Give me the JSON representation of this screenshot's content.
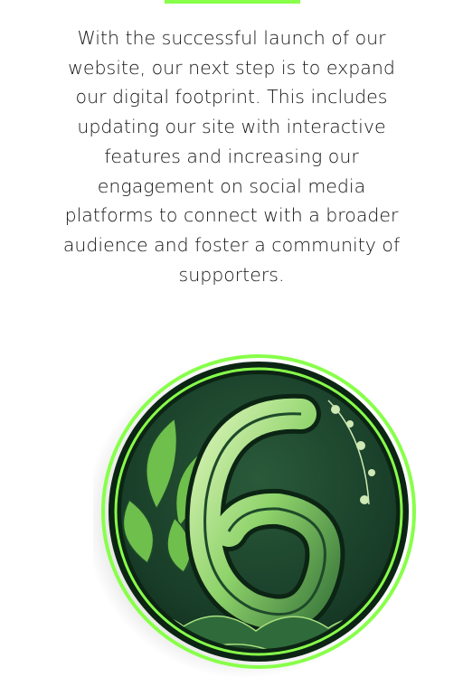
{
  "roadmap": {
    "description": "With the successful launch of our website, our next step is to expand our digital footprint. This includes updating our site with interactive features and increasing our engagement on social media platforms to connect with a broader audience and foster a community of supporters.",
    "step_numeral": "6"
  },
  "colors": {
    "accent": "#88ff4a",
    "ring_dark": "#0c2414",
    "medallion_bg": "#173b27",
    "foliage": "#8fd36b"
  },
  "icons": {
    "medallion": "number-six-illustration"
  }
}
